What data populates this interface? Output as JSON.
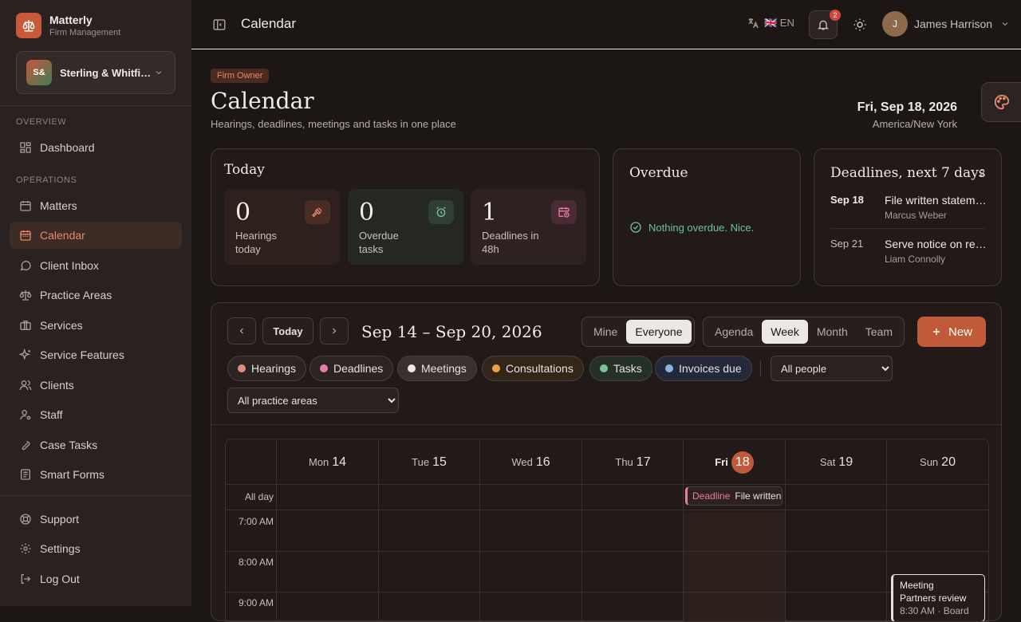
{
  "brand": {
    "name": "Matterly",
    "subtitle": "Firm Management"
  },
  "firm": {
    "initials": "S&",
    "name": "Sterling & Whitfield"
  },
  "sidebar": {
    "overview_label": "OVERVIEW",
    "operations_label": "OPERATIONS",
    "items": [
      {
        "label": "Dashboard",
        "icon": "grid-icon"
      },
      {
        "label": "Matters",
        "icon": "calendar-icon"
      },
      {
        "label": "Calendar",
        "icon": "calendar-icon",
        "active": true
      },
      {
        "label": "Client Inbox",
        "icon": "chat-icon"
      },
      {
        "label": "Practice Areas",
        "icon": "scale-icon"
      },
      {
        "label": "Services",
        "icon": "briefcase-icon"
      },
      {
        "label": "Service Features",
        "icon": "sparkle-icon"
      },
      {
        "label": "Clients",
        "icon": "users-icon"
      },
      {
        "label": "Staff",
        "icon": "user-gear-icon"
      },
      {
        "label": "Case Tasks",
        "icon": "wrench-icon"
      },
      {
        "label": "Smart Forms",
        "icon": "form-icon"
      }
    ],
    "footer": [
      {
        "label": "Support",
        "icon": "lifebuoy-icon"
      },
      {
        "label": "Settings",
        "icon": "gear-icon"
      },
      {
        "label": "Log Out",
        "icon": "logout-icon"
      }
    ]
  },
  "topbar": {
    "title": "Calendar",
    "language": "🇬🇧 EN",
    "notification_count": "2",
    "user_initial": "J",
    "user_name": "James Harrison"
  },
  "header": {
    "role_badge": "Firm Owner",
    "title": "Calendar",
    "subtitle": "Hearings, deadlines, meetings and tasks in one place",
    "date": "Fri, Sep 18, 2026",
    "timezone": "America/New York"
  },
  "today_card": {
    "title": "Today",
    "stats": [
      {
        "value": "0",
        "label": "Hearings today",
        "icon": "gavel-icon"
      },
      {
        "value": "0",
        "label": "Overdue tasks",
        "icon": "alarm-icon"
      },
      {
        "value": "1",
        "label": "Deadlines in 48h",
        "icon": "calendar-clock-icon"
      }
    ]
  },
  "overdue_card": {
    "title": "Overdue",
    "message": "Nothing overdue. Nice."
  },
  "deadlines_card": {
    "title": "Deadlines, next 7 days",
    "count": "2",
    "items": [
      {
        "date": "Sep 18",
        "text": "File written statement",
        "who": "Marcus Weber"
      },
      {
        "date": "Sep 21",
        "text": "Serve notice on respondent",
        "who": "Liam Connolly"
      }
    ]
  },
  "calendar": {
    "today_button": "Today",
    "range": "Sep 14 – Sep 20, 2026",
    "scope": [
      "Mine",
      "Everyone"
    ],
    "views": [
      "Agenda",
      "Week",
      "Month",
      "Team"
    ],
    "new_button": "New",
    "filters": [
      {
        "label": "Hearings",
        "color": "#e08f7a"
      },
      {
        "label": "Deadlines",
        "color": "#e47ea8"
      },
      {
        "label": "Meetings",
        "color": "#f0ebe6"
      },
      {
        "label": "Consultations",
        "color": "#e8a24a"
      },
      {
        "label": "Tasks",
        "color": "#7cc39a"
      },
      {
        "label": "Invoices due",
        "color": "#8fb3e0"
      }
    ],
    "people_select": "All people",
    "practice_select": "All practice areas",
    "days": [
      {
        "dow": "Mon",
        "num": "14"
      },
      {
        "dow": "Tue",
        "num": "15"
      },
      {
        "dow": "Wed",
        "num": "16"
      },
      {
        "dow": "Thu",
        "num": "17"
      },
      {
        "dow": "Fri",
        "num": "18"
      },
      {
        "dow": "Sat",
        "num": "19"
      },
      {
        "dow": "Sun",
        "num": "20"
      }
    ],
    "allday_label": "All day",
    "times": [
      "7:00 AM",
      "8:00 AM",
      "9:00 AM"
    ],
    "allday_event": {
      "type": "Deadline",
      "title": "File written statement"
    },
    "meeting_event": {
      "title": "Meeting",
      "subtitle": "Partners review",
      "time": "8:30 AM · Board"
    }
  }
}
